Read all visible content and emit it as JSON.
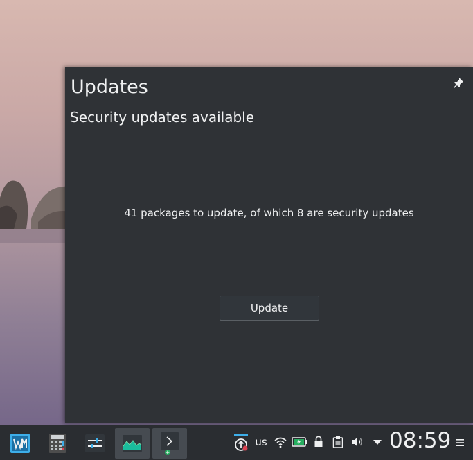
{
  "popup": {
    "title": "Updates",
    "subtitle": "Security updates available",
    "message": "41 packages to update, of which 8 are security updates",
    "update_button_label": "Update"
  },
  "taskbar": {
    "launchers": [
      {
        "icon": "kwin-icon"
      },
      {
        "icon": "calculator-icon"
      },
      {
        "icon": "system-settings-icon"
      },
      {
        "icon": "system-monitor-icon"
      },
      {
        "icon": "terminal-icon"
      }
    ],
    "tray": {
      "keyboard_layout": "us",
      "clock": "08:59"
    }
  },
  "colors": {
    "panel_bg": "#2a2d31",
    "popup_bg": "#2f3236",
    "text": "#eff0f1",
    "accent": "#3daee9"
  }
}
